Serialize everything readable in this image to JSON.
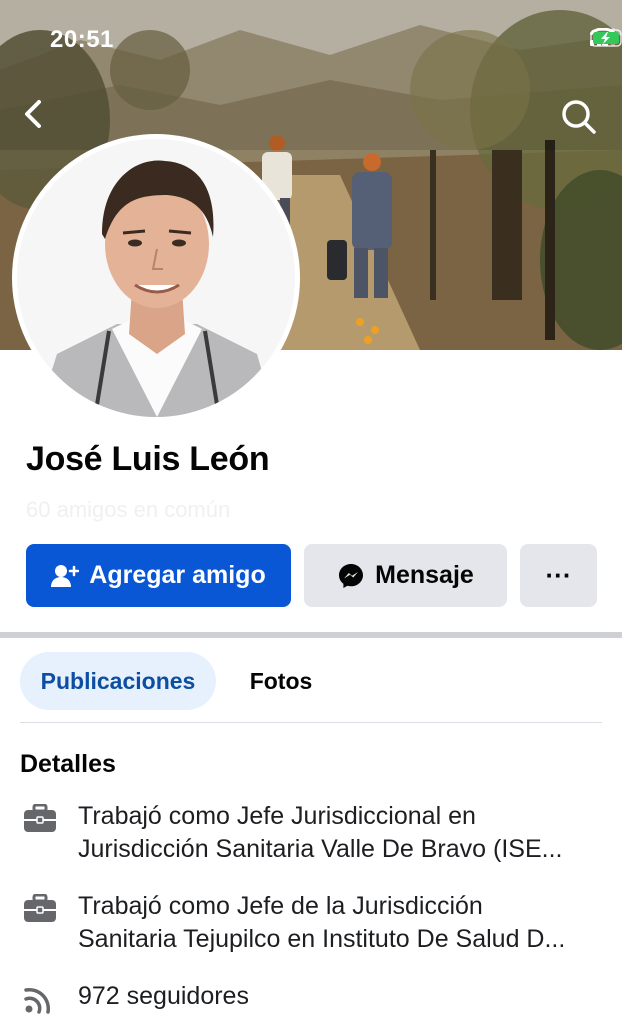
{
  "status_bar": {
    "time": "20:51"
  },
  "icons": {
    "back": "chevron-left-icon",
    "search": "search-icon",
    "add_friend": "person-add-icon",
    "message": "messenger-icon",
    "more": "ellipsis-icon",
    "work": "briefcase-icon",
    "followers": "rss-feed-icon"
  },
  "profile": {
    "name": "José Luis León",
    "mutual_friends": "60 amigos en común"
  },
  "actions": {
    "add_friend_label": "Agregar amigo",
    "message_label": "Mensaje",
    "more_label": "···"
  },
  "tabs": [
    {
      "label": "Publicaciones",
      "active": true
    },
    {
      "label": "Fotos",
      "active": false
    }
  ],
  "details": {
    "title": "Detalles",
    "items": [
      {
        "line1": "Trabajó como Jefe Jurisdiccional en",
        "line2": "Jurisdicción Sanitaria Valle De Bravo (ISE..."
      },
      {
        "line1": "Trabajó como Jefe de la Jurisdicción",
        "line2": "Sanitaria Tejupilco en Instituto De Salud D..."
      },
      {
        "line1": "972 seguidores"
      }
    ]
  },
  "colors": {
    "primary_button": "#0a57d6",
    "secondary_button": "#e4e6eb",
    "active_tab_bg": "#e7f1fd",
    "active_tab_text": "#0b4ea2"
  }
}
